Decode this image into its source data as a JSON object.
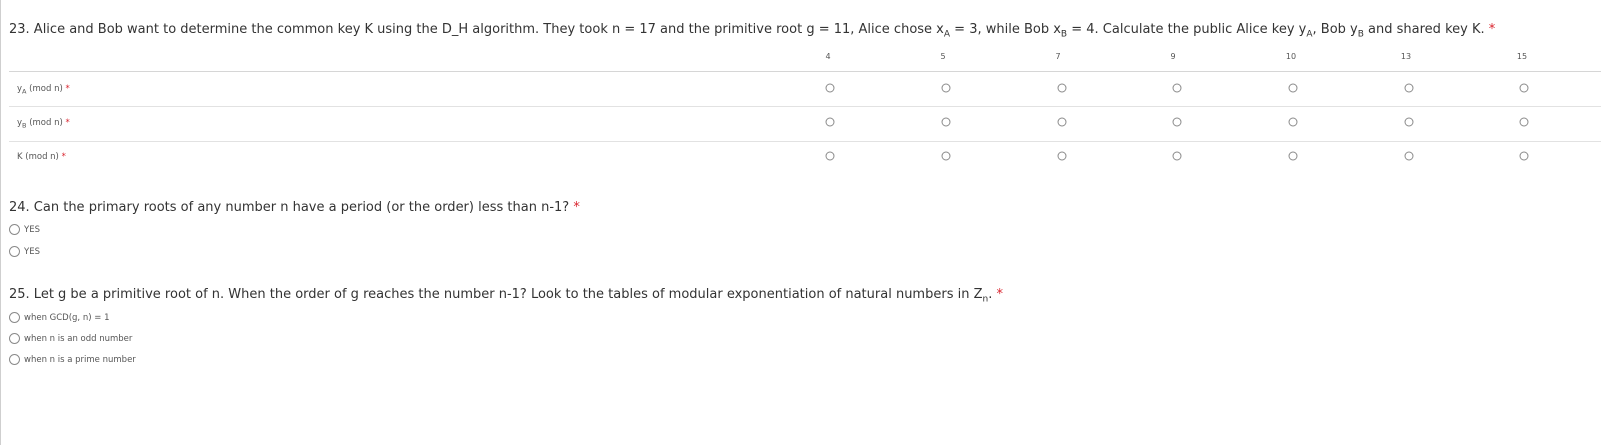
{
  "q23": {
    "title_pre": "23. Alice and Bob want to determine the common key K using the D_H algorithm. They took n = 17 and the primitive root g = 11, Alice chose x",
    "sub_a": "A",
    "title_mid1": " = 3, while Bob x",
    "sub_b": "B",
    "title_mid2": " = 4. Calculate the public Alice key y",
    "sub_a2": "A",
    "title_mid3": ", Bob y",
    "sub_b2": "B",
    "title_post": " and shared key K.",
    "required": "*",
    "columns": [
      "4",
      "5",
      "7",
      "9",
      "10",
      "13",
      "15"
    ],
    "rows": [
      {
        "pre": "y",
        "sub": "A",
        "post": " (mod n)",
        "required": "*"
      },
      {
        "pre": "y",
        "sub": "B",
        "post": " (mod n)",
        "required": "*"
      },
      {
        "pre": "K (mod n)",
        "sub": "",
        "post": "",
        "required": "*"
      }
    ]
  },
  "q24": {
    "title": "24. Can the primary roots of any number n have a period (or the order) less than n-1?",
    "required": "*",
    "options": [
      "YES",
      "YES"
    ]
  },
  "q25": {
    "title_pre": "25. Let g be a primitive root of n. When the order of g reaches the number n-1? Look to the tables of modular exponentiation of natural numbers in Z",
    "sub_n": "n",
    "title_post": ".",
    "required": "*",
    "options": [
      "when GCD(g, n) = 1",
      "when n is an odd number",
      "when n is a prime number"
    ]
  }
}
